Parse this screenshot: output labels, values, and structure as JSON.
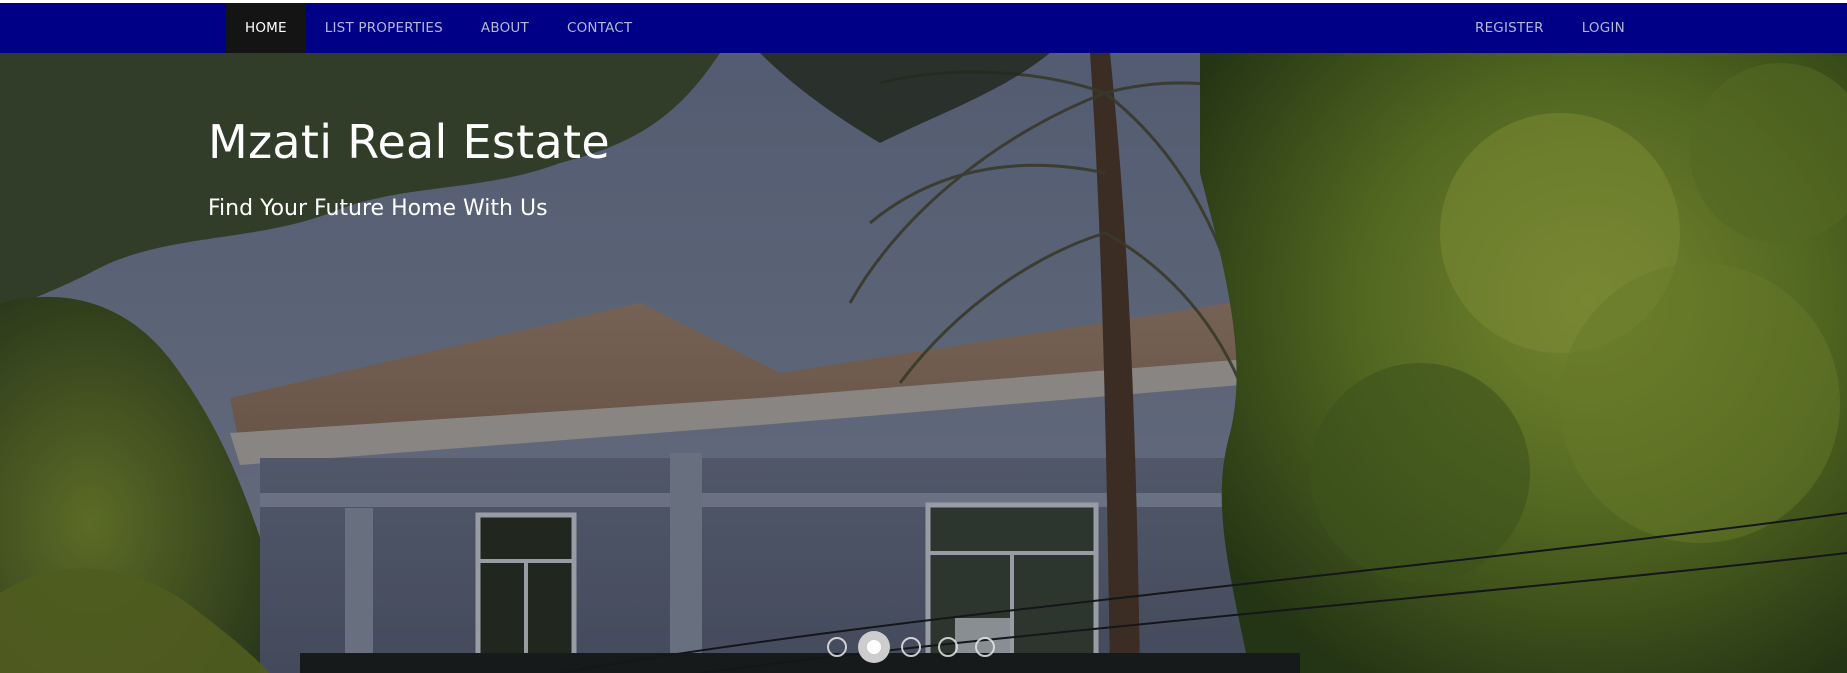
{
  "nav": {
    "left_items": [
      {
        "label": "HOME",
        "active": true
      },
      {
        "label": "LIST PROPERTIES",
        "active": false
      },
      {
        "label": "ABOUT",
        "active": false
      },
      {
        "label": "CONTACT",
        "active": false
      }
    ],
    "right_items": [
      {
        "label": "REGISTER"
      },
      {
        "label": "LOGIN"
      }
    ],
    "bar_color": "#000086",
    "active_bg": "#141414"
  },
  "hero": {
    "title": "Mzati Real Estate",
    "subtitle": "Find Your Future Home With Us",
    "image": "house-photo",
    "carousel": {
      "slide_count": 5,
      "active_index": 1
    }
  }
}
